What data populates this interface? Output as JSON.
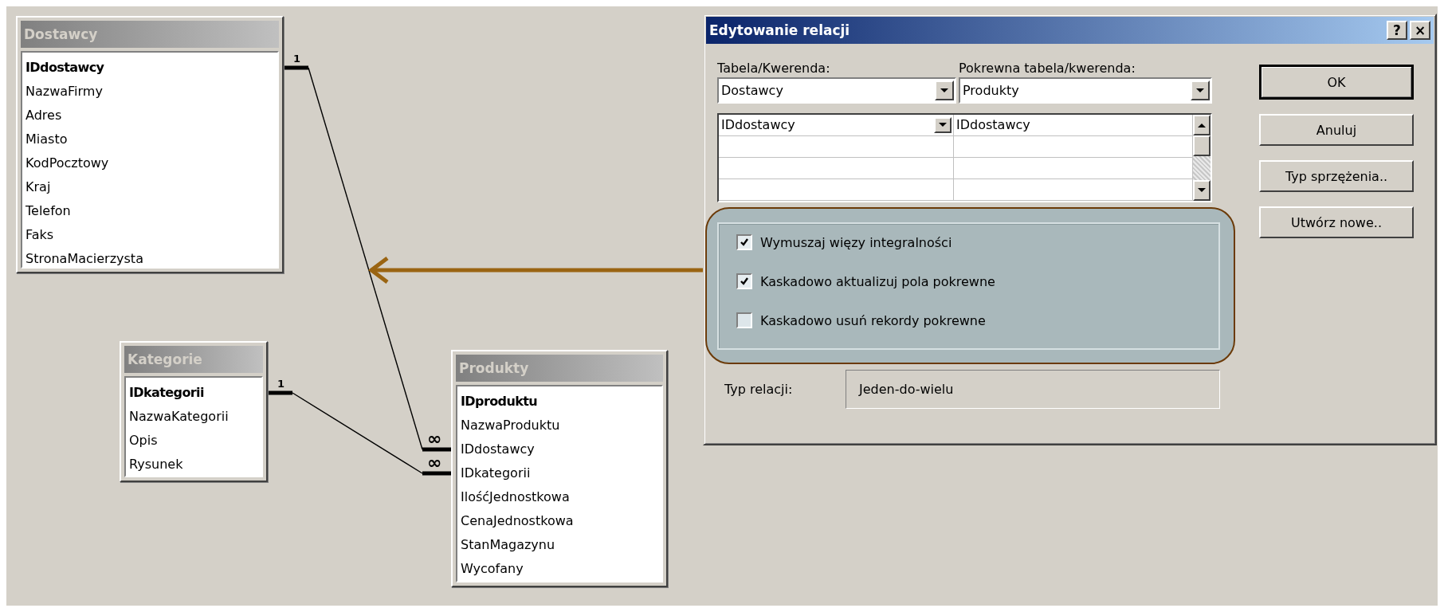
{
  "tables": [
    {
      "title": "Dostawcy",
      "fields": [
        {
          "name": "IDdostawcy",
          "primary_key": true
        },
        {
          "name": "NazwaFirmy",
          "primary_key": false
        },
        {
          "name": "Adres",
          "primary_key": false
        },
        {
          "name": "Miasto",
          "primary_key": false
        },
        {
          "name": "KodPocztowy",
          "primary_key": false
        },
        {
          "name": "Kraj",
          "primary_key": false
        },
        {
          "name": "Telefon",
          "primary_key": false
        },
        {
          "name": "Faks",
          "primary_key": false
        },
        {
          "name": "StronaMacierzysta",
          "primary_key": false
        }
      ]
    },
    {
      "title": "Kategorie",
      "fields": [
        {
          "name": "IDkategorii",
          "primary_key": true
        },
        {
          "name": "NazwaKategorii",
          "primary_key": false
        },
        {
          "name": "Opis",
          "primary_key": false
        },
        {
          "name": "Rysunek",
          "primary_key": false
        }
      ]
    },
    {
      "title": "Produkty",
      "fields": [
        {
          "name": "IDproduktu",
          "primary_key": true
        },
        {
          "name": "NazwaProduktu",
          "primary_key": false
        },
        {
          "name": "IDdostawcy",
          "primary_key": false
        },
        {
          "name": "IDkategorii",
          "primary_key": false
        },
        {
          "name": "IlośćJednostkowa",
          "primary_key": false
        },
        {
          "name": "CenaJednostkowa",
          "primary_key": false
        },
        {
          "name": "StanMagazynu",
          "primary_key": false
        },
        {
          "name": "Wycofany",
          "primary_key": false
        }
      ]
    }
  ],
  "relationships": [
    {
      "one_label": "1",
      "many_label": "∞"
    },
    {
      "one_label": "1",
      "many_label": "∞"
    }
  ],
  "dialog": {
    "title": "Edytowanie relacji",
    "title_buttons": [
      "?",
      "×"
    ],
    "table_label": "Tabela/Kwerenda:",
    "related_label": "Pokrewna tabela/kwerenda:",
    "table_value": "Dostawcy",
    "related_value": "Produkty",
    "field_rows": [
      {
        "left": "IDdostawcy",
        "right": "IDdostawcy"
      }
    ],
    "options": [
      {
        "label": "Wymuszaj więzy integralności",
        "checked": true
      },
      {
        "label": "Kaskadowo aktualizuj pola pokrewne",
        "checked": true
      },
      {
        "label": "Kaskadowo usuń rekordy pokrewne",
        "checked": false
      }
    ],
    "relation_type_label": "Typ relacji:",
    "relation_type_value": "Jeden-do-wielu",
    "buttons": [
      {
        "label": "OK",
        "default": true
      },
      {
        "label": "Anuluj",
        "default": false
      },
      {
        "label": "Typ sprzężenia..",
        "default": false
      },
      {
        "label": "Utwórz nowe..",
        "default": false
      }
    ]
  }
}
